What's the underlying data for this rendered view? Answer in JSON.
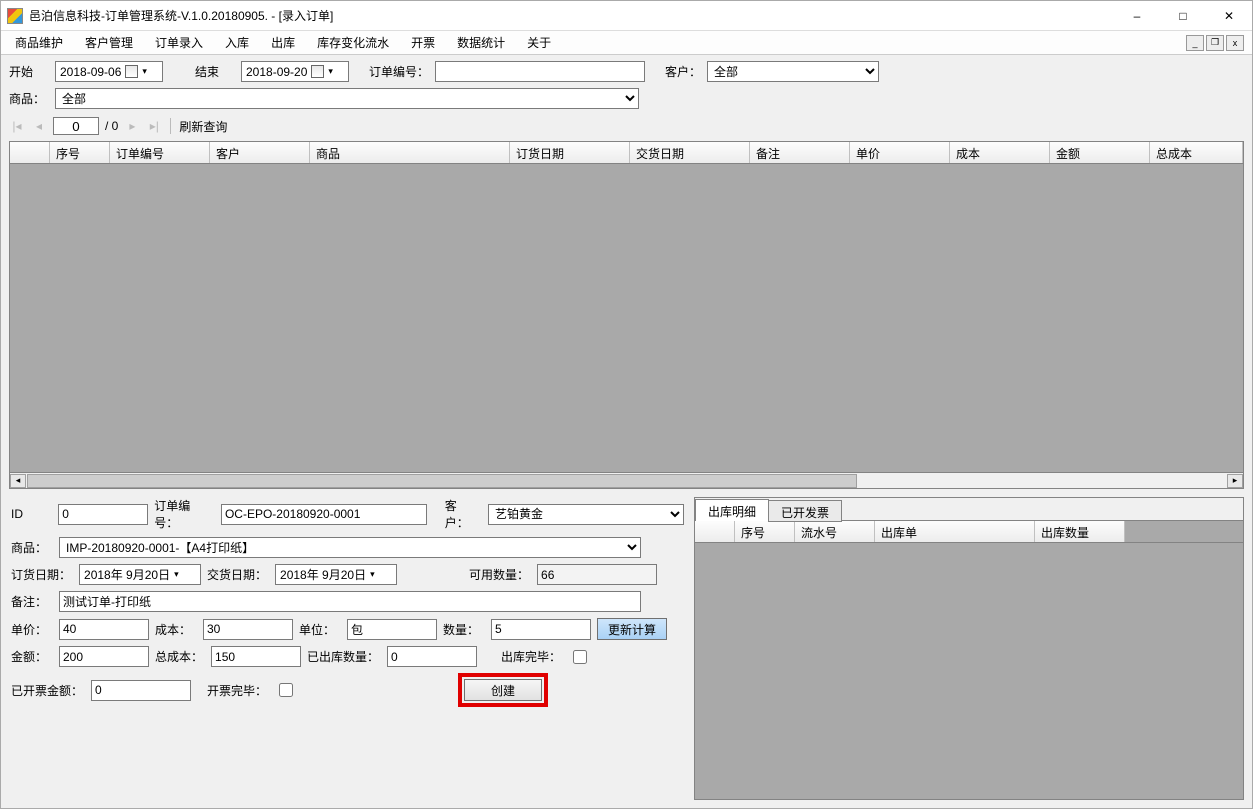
{
  "window": {
    "title": "邑泊信息科技-订单管理系统-V.1.0.20180905. - [录入订单]"
  },
  "menu": {
    "items": [
      "商品维护",
      "客户管理",
      "订单录入",
      "入库",
      "出库",
      "库存变化流水",
      "开票",
      "数据统计",
      "关于"
    ]
  },
  "filters": {
    "start_label": "开始",
    "start_value": "2018-09-06",
    "end_label": "结束",
    "end_value": "2018-09-20",
    "order_no_label": "订单编号：",
    "order_no_value": "",
    "customer_label": "客户：",
    "customer_value": "全部",
    "product_label": "商品：",
    "product_value": "全部"
  },
  "pager": {
    "current": "0",
    "total_text": "/ 0",
    "refresh_label": "刷新查询"
  },
  "grid": {
    "columns": [
      "",
      "序号",
      "订单编号",
      "客户",
      "商品",
      "订货日期",
      "交货日期",
      "备注",
      "单价",
      "成本",
      "金额",
      "总成本"
    ]
  },
  "form": {
    "id_label": "ID",
    "id_value": "0",
    "order_no_label": "订单编号：",
    "order_no_value": "OC-EPO-20180920-0001",
    "customer_label": "客户：",
    "customer_value": "艺铂黄金",
    "product_label": "商品：",
    "product_value": "IMP-20180920-0001-【A4打印纸】",
    "order_date_label": "订货日期：",
    "order_date_value": "2018年 9月20日",
    "delivery_date_label": "交货日期：",
    "delivery_date_value": "2018年 9月20日",
    "avail_qty_label": "可用数量：",
    "avail_qty_value": "66",
    "remark_label": "备注：",
    "remark_value": "测试订单-打印纸",
    "unit_price_label": "单价：",
    "unit_price_value": "40",
    "cost_label": "成本：",
    "cost_value": "30",
    "unit_label": "单位：",
    "unit_value": "包",
    "qty_label": "数量：",
    "qty_value": "5",
    "recalc_btn": "更新计算",
    "amount_label": "金额：",
    "amount_value": "200",
    "total_cost_label": "总成本：",
    "total_cost_value": "150",
    "shipped_qty_label": "已出库数量：",
    "shipped_qty_value": "0",
    "shipped_done_label": "出库完毕：",
    "invoiced_amount_label": "已开票金额：",
    "invoiced_amount_value": "0",
    "invoice_done_label": "开票完毕：",
    "create_btn": "创建"
  },
  "right": {
    "tab1": "出库明细",
    "tab2": "已开发票",
    "columns": [
      "",
      "序号",
      "流水号",
      "出库单",
      "出库数量"
    ]
  }
}
